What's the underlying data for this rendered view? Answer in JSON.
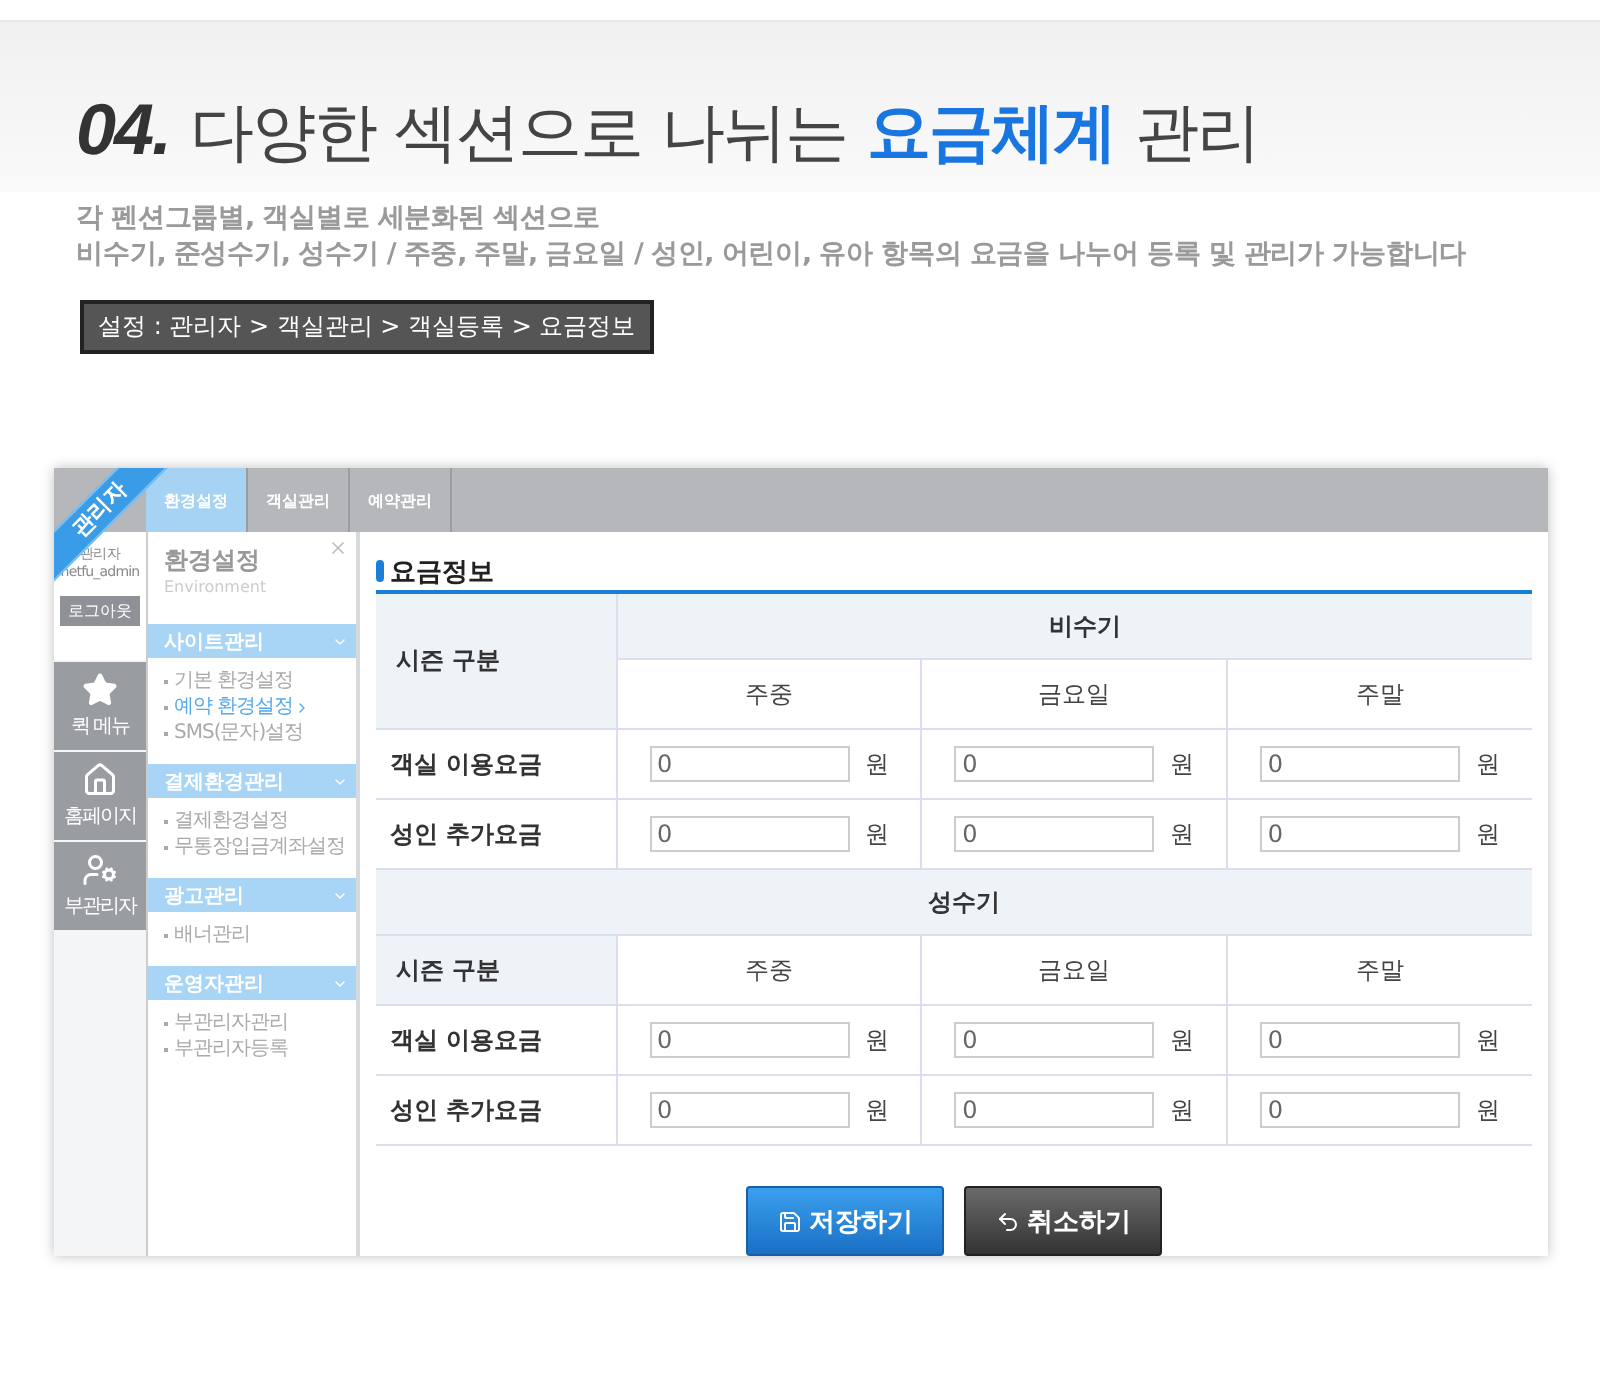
{
  "heading": {
    "number": "04.",
    "before": "다양한 섹션으로 나뉘는",
    "highlight": "요금체계",
    "after": "관리"
  },
  "description": [
    "각 펜션그룹별,  객실별로 세분화된 섹션으로",
    "비수기, 준성수기, 성수기 / 주중, 주말, 금요일 / 성인, 어린이, 유아 항목의 요금을 나누어 등록 및 관리가 가능합니다"
  ],
  "breadcrumb": "설정 : 관리자 > 객실관리 > 객실등록 > 요금정보",
  "admin_panel": {
    "ribbon": "관리자",
    "tabs": [
      {
        "label": "환경설정",
        "selected": true
      },
      {
        "label": "객실관리",
        "selected": false
      },
      {
        "label": "예약관리",
        "selected": false
      }
    ],
    "user": {
      "role": "관리자",
      "id": "netfu_admin",
      "logout": "로그아웃"
    },
    "quick_menu": [
      {
        "kind": "favorites",
        "label": "퀵 메뉴"
      },
      {
        "kind": "home",
        "label": "홈페이지"
      },
      {
        "kind": "subadmin",
        "label": "부관리자"
      }
    ],
    "sidebar": {
      "title": "환경설정",
      "subtitle": "Environment",
      "sections": [
        {
          "title": "사이트관리",
          "items": [
            {
              "label": "기본 환경설정",
              "selected": false
            },
            {
              "label": "예약 환경설정",
              "selected": true
            },
            {
              "label": "SMS(문자)설정",
              "selected": false
            }
          ]
        },
        {
          "title": "결제환경관리",
          "items": [
            {
              "label": "결제환경설정",
              "selected": false
            },
            {
              "label": "무통장입금계좌설정",
              "selected": false
            }
          ]
        },
        {
          "title": "광고관리",
          "items": [
            {
              "label": "배너관리",
              "selected": false
            }
          ]
        },
        {
          "title": "운영자관리",
          "items": [
            {
              "label": "부관리자관리",
              "selected": false
            },
            {
              "label": "부관리자등록",
              "selected": false
            }
          ]
        }
      ]
    },
    "fee_table": {
      "title": "요금정보",
      "seasons": [
        {
          "kind": "merged",
          "name": "비수기",
          "header": "시즌 구분",
          "periods": [
            "주중",
            "금요일",
            "주말"
          ],
          "rows": [
            {
              "label": "객실 이용요금",
              "cells": [
                {
                  "value": "0",
                  "unit": "원"
                },
                {
                  "value": "0",
                  "unit": "원"
                },
                {
                  "value": "0",
                  "unit": "원"
                }
              ]
            },
            {
              "label": "성인 추가요금",
              "cells": [
                {
                  "value": "0",
                  "unit": "원"
                },
                {
                  "value": "0",
                  "unit": "원"
                },
                {
                  "value": "0",
                  "unit": "원"
                }
              ]
            }
          ]
        },
        {
          "kind": "banner",
          "name": "성수기",
          "header": "시즌 구분",
          "periods": [
            "주중",
            "금요일",
            "주말"
          ],
          "rows": [
            {
              "label": "객실 이용요금",
              "cells": [
                {
                  "value": "0",
                  "unit": "원"
                },
                {
                  "value": "0",
                  "unit": "원"
                },
                {
                  "value": "0",
                  "unit": "원"
                }
              ]
            },
            {
              "label": "성인 추가요금",
              "cells": [
                {
                  "value": "0",
                  "unit": "원"
                },
                {
                  "value": "0",
                  "unit": "원"
                },
                {
                  "value": "0",
                  "unit": "원"
                }
              ]
            }
          ]
        }
      ]
    },
    "buttons": [
      {
        "kind": "save",
        "label": "저장하기"
      },
      {
        "kind": "cancel",
        "label": "취소하기"
      }
    ]
  }
}
